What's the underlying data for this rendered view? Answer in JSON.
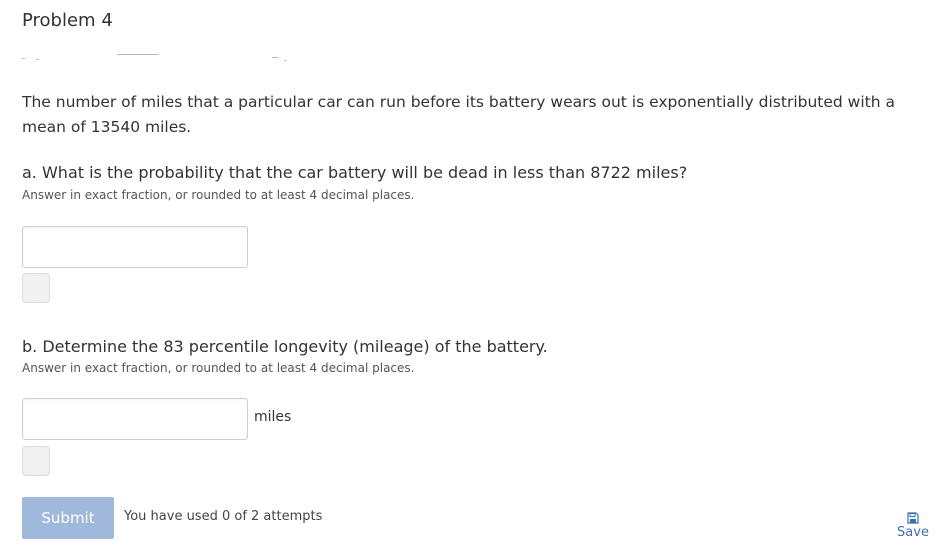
{
  "problem": {
    "title": "Problem 4"
  },
  "question": {
    "stem": "The number of miles that a particular car can run before its battery wears out is exponentially distributed with a mean of 13540 miles."
  },
  "part_a": {
    "prompt": "a. What is the probability that the car battery will be dead in less than 8722 miles?",
    "hint": "Answer in exact fraction, or rounded to at least 4 decimal places.",
    "input_value": ""
  },
  "part_b": {
    "prompt": "b. Determine the 83 percentile longevity (mileage) of the battery.",
    "hint": "Answer in exact fraction, or rounded to at least 4 decimal places.",
    "input_value": "",
    "unit": "miles"
  },
  "footer": {
    "submit_label": "Submit",
    "attempts_text": "You have used 0 of 2 attempts",
    "save_label": "Save"
  },
  "icons": {
    "save": "floppy-disk-icon"
  },
  "colors": {
    "submit_bg": "#9fb8dc",
    "link": "#3a6fb0",
    "text": "#333333"
  }
}
